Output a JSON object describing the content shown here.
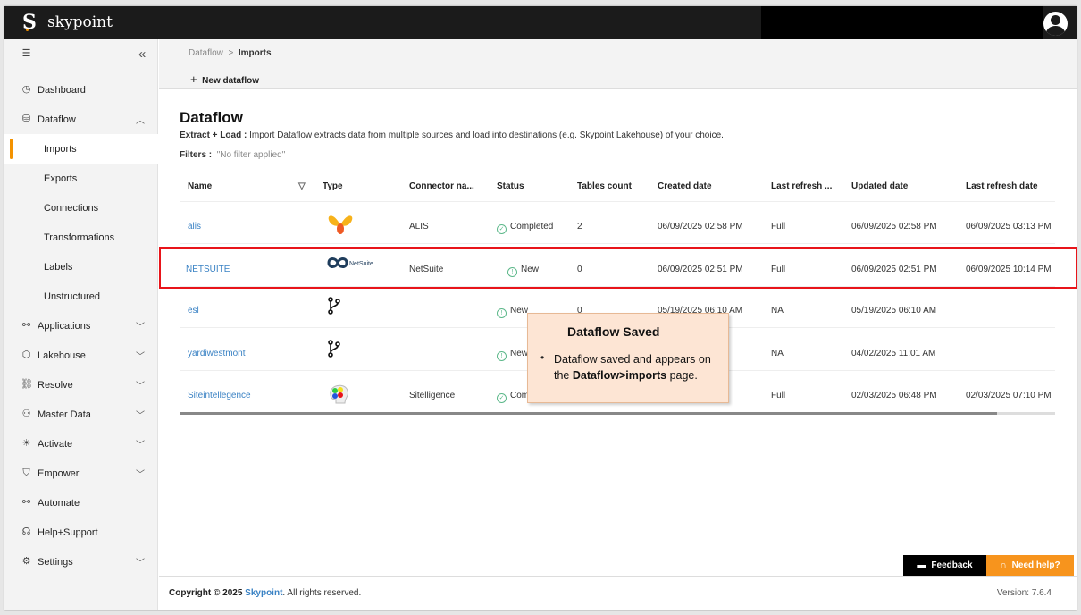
{
  "app": {
    "logo_letter": "S",
    "name": "skypoint"
  },
  "colors": {
    "accent": "#f39200",
    "link": "#3a82c4",
    "highlight": "#e8141a",
    "header": "#1b1b1b"
  },
  "sidebar": {
    "items": [
      {
        "label": "Dashboard",
        "icon": "dashboard-icon"
      },
      {
        "label": "Dataflow",
        "icon": "dataflow-icon",
        "expanded": true
      },
      {
        "label": "Imports",
        "sub": true,
        "active": true
      },
      {
        "label": "Exports",
        "sub": true
      },
      {
        "label": "Connections",
        "sub": true
      },
      {
        "label": "Transformations",
        "sub": true
      },
      {
        "label": "Labels",
        "sub": true
      },
      {
        "label": "Unstructured",
        "sub": true
      },
      {
        "label": "Applications",
        "icon": "applications-icon"
      },
      {
        "label": "Lakehouse",
        "icon": "lakehouse-icon"
      },
      {
        "label": "Resolve",
        "icon": "resolve-icon"
      },
      {
        "label": "Master Data",
        "icon": "master-data-icon"
      },
      {
        "label": "Activate",
        "icon": "activate-icon"
      },
      {
        "label": "Empower",
        "icon": "empower-icon"
      },
      {
        "label": "Automate",
        "icon": "automate-icon"
      },
      {
        "label": "Help+Support",
        "icon": "help-icon"
      },
      {
        "label": "Settings",
        "icon": "settings-icon"
      }
    ]
  },
  "breadcrumb": {
    "parent": "Dataflow",
    "current": "Imports"
  },
  "toolbar": {
    "new_dataflow": "New dataflow"
  },
  "page": {
    "title": "Dataflow",
    "desc_bold": "Extract + Load :",
    "desc": " Import Dataflow extracts data from multiple sources and load into destinations (e.g. Skypoint Lakehouse) of your choice.",
    "filters_label": "Filters :",
    "filters_value": "\"No filter applied\""
  },
  "table": {
    "columns": [
      "Name",
      "Type",
      "Connector na...",
      "Status",
      "Tables count",
      "Created date",
      "Last refresh ...",
      "Updated date",
      "Last refresh date"
    ],
    "rows": [
      {
        "name": "alis",
        "type": "alis-logo",
        "connector": "ALIS",
        "status": "Completed",
        "tables": "2",
        "created": "06/09/2025 02:58 PM",
        "refresh_type": "Full",
        "updated": "06/09/2025 02:58 PM",
        "last_refresh": "06/09/2025 03:13 PM"
      },
      {
        "name": "NETSUITE",
        "type": "netsuite-logo",
        "connector": "NetSuite",
        "status": "New",
        "tables": "0",
        "created": "06/09/2025 02:51 PM",
        "refresh_type": "Full",
        "updated": "06/09/2025 02:51 PM",
        "last_refresh": "06/09/2025 10:14 PM",
        "highlighted": true
      },
      {
        "name": "esl",
        "type": "git-branch-icon",
        "connector": "",
        "status": "New",
        "tables": "0",
        "created": "05/19/2025 06:10 AM",
        "refresh_type": "NA",
        "updated": "05/19/2025 06:10 AM",
        "last_refresh": ""
      },
      {
        "name": "yardiwestmont",
        "type": "git-branch-icon",
        "connector": "",
        "status": "New",
        "tables": "",
        "created": "AM",
        "refresh_type": "NA",
        "updated": "04/02/2025 11:01 AM",
        "last_refresh": ""
      },
      {
        "name": "Siteintellegence",
        "type": "brain-gears-logo",
        "connector": "Sitelligence",
        "status": "Com",
        "tables": "",
        "created": "PM",
        "refresh_type": "Full",
        "updated": "02/03/2025 06:48 PM",
        "last_refresh": "02/03/2025 07:10 PM"
      }
    ]
  },
  "tooltip": {
    "title": "Dataflow Saved",
    "text1": "Dataflow saved and appears on the ",
    "text_bold": "Dataflow>imports",
    "text2": " page."
  },
  "footer": {
    "copyright": "Copyright © 2025",
    "brand": "Skypoint",
    "rights": ". All rights reserved.",
    "version": "Version: 7.6.4",
    "feedback": "Feedback",
    "help": "Need help?"
  }
}
